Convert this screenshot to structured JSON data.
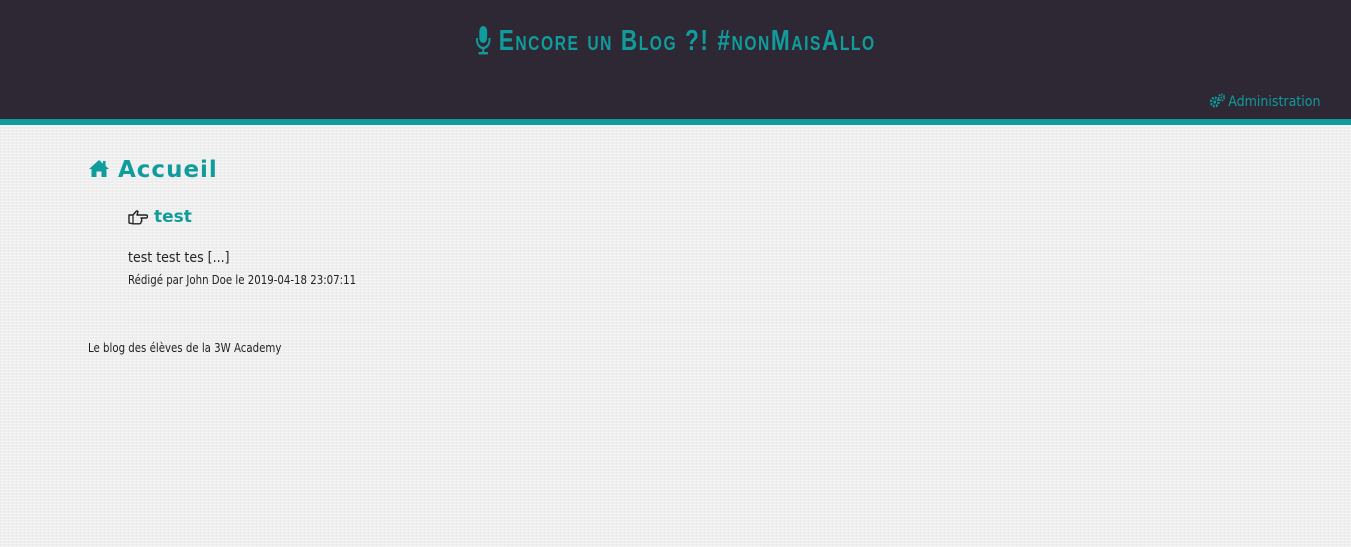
{
  "header": {
    "title": "Encore un Blog ?! #nonMaisAllo",
    "title_icon": "microphone-icon",
    "admin_label": "Administration",
    "admin_icon": "cogs-icon"
  },
  "main": {
    "heading": "Accueil",
    "heading_icon": "home-icon",
    "posts": [
      {
        "title": "test",
        "title_icon": "hand-pointing-right-icon",
        "excerpt": "test test tes  [...]",
        "meta": "Rédigé par John Doe le 2019-04-18 23:07:11"
      }
    ]
  },
  "footer": {
    "text": "Le blog des élèves de la 3W Academy"
  },
  "colors": {
    "accent": "#109c9c",
    "header_bg": "#2d2834",
    "page_bg": "#eeeeee"
  }
}
